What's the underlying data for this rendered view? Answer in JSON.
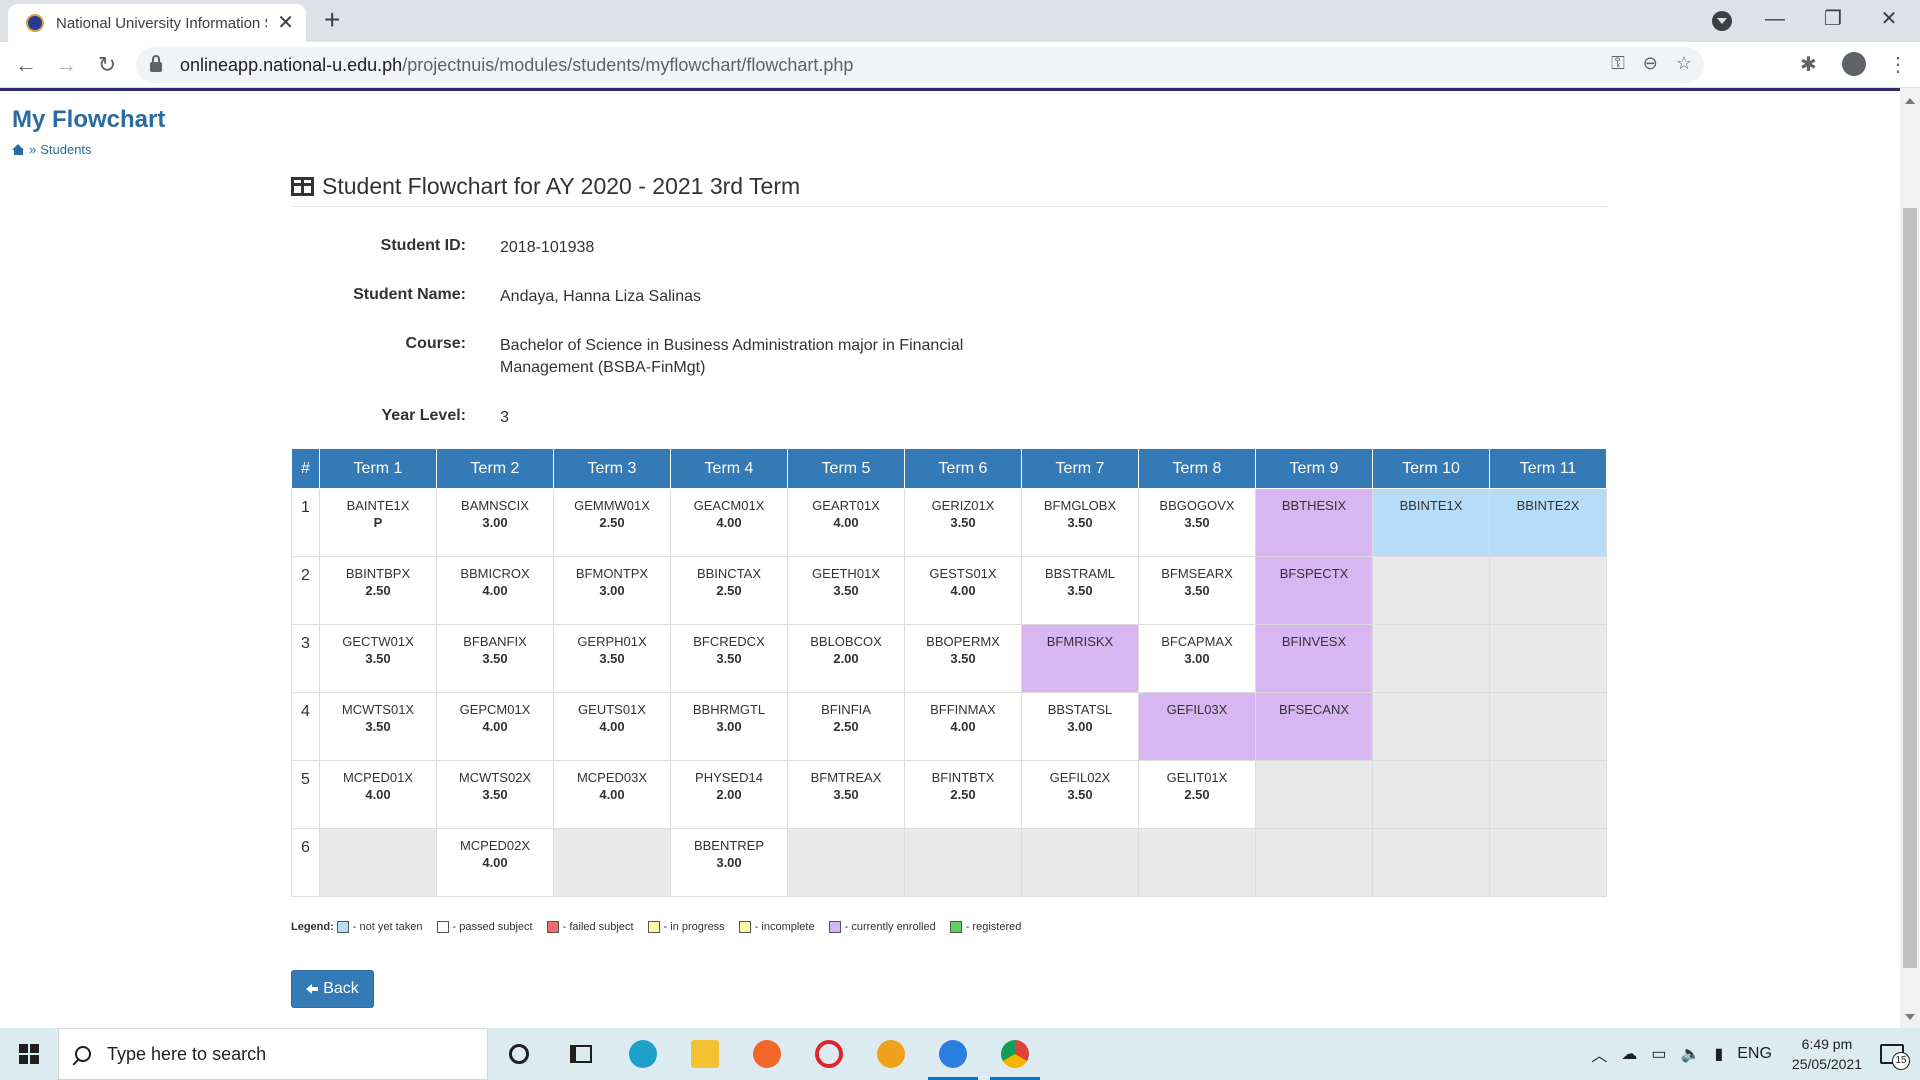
{
  "browser": {
    "tab_title": "National University Information S",
    "url_host": "onlineapp.national-u.edu.ph",
    "url_path": "/projectnuis/modules/students/myflowchart/flowchart.php"
  },
  "page": {
    "title": "My Flowchart",
    "breadcrumb": "Students",
    "breadcrumb_sep": "»",
    "section_title": "Student Flowchart for AY 2020 - 2021 3rd Term"
  },
  "student": {
    "id_label": "Student ID:",
    "id": "2018-101938",
    "name_label": "Student Name:",
    "name": "Andaya, Hanna Liza Salinas",
    "course_label": "Course:",
    "course": "Bachelor of Science in Business Administration major in Financial Management (BSBA-FinMgt)",
    "year_label": "Year Level:",
    "year": "3"
  },
  "flowchart": {
    "headers": [
      "#",
      "Term 1",
      "Term 2",
      "Term 3",
      "Term 4",
      "Term 5",
      "Term 6",
      "Term 7",
      "Term 8",
      "Term 9",
      "Term 10",
      "Term 11"
    ],
    "rows": [
      {
        "num": "1",
        "cells": [
          {
            "code": "BAINTE1X",
            "grade": "P",
            "status": "passed"
          },
          {
            "code": "BAMNSCIX",
            "grade": "3.00",
            "status": "passed"
          },
          {
            "code": "GEMMW01X",
            "grade": "2.50",
            "status": "passed"
          },
          {
            "code": "GEACM01X",
            "grade": "4.00",
            "status": "passed"
          },
          {
            "code": "GEART01X",
            "grade": "4.00",
            "status": "passed"
          },
          {
            "code": "GERIZ01X",
            "grade": "3.50",
            "status": "passed"
          },
          {
            "code": "BFMGLOBX",
            "grade": "3.50",
            "status": "passed"
          },
          {
            "code": "BBGOGOVX",
            "grade": "3.50",
            "status": "passed"
          },
          {
            "code": "BBTHESIX",
            "grade": "",
            "status": "enrolled"
          },
          {
            "code": "BBINTE1X",
            "grade": "",
            "status": "nottaken"
          },
          {
            "code": "BBINTE2X",
            "grade": "",
            "status": "nottaken"
          }
        ]
      },
      {
        "num": "2",
        "cells": [
          {
            "code": "BBINTBPX",
            "grade": "2.50",
            "status": "passed"
          },
          {
            "code": "BBMICROX",
            "grade": "4.00",
            "status": "passed"
          },
          {
            "code": "BFMONTPX",
            "grade": "3.00",
            "status": "passed"
          },
          {
            "code": "BBINCTAX",
            "grade": "2.50",
            "status": "passed"
          },
          {
            "code": "GEETH01X",
            "grade": "3.50",
            "status": "passed"
          },
          {
            "code": "GESTS01X",
            "grade": "4.00",
            "status": "passed"
          },
          {
            "code": "BBSTRAML",
            "grade": "3.50",
            "status": "passed"
          },
          {
            "code": "BFMSEARX",
            "grade": "3.50",
            "status": "passed"
          },
          {
            "code": "BFSPECTX",
            "grade": "",
            "status": "enrolled"
          },
          {
            "code": "",
            "grade": "",
            "status": "empty"
          },
          {
            "code": "",
            "grade": "",
            "status": "empty"
          }
        ]
      },
      {
        "num": "3",
        "cells": [
          {
            "code": "GECTW01X",
            "grade": "3.50",
            "status": "passed"
          },
          {
            "code": "BFBANFIX",
            "grade": "3.50",
            "status": "passed"
          },
          {
            "code": "GERPH01X",
            "grade": "3.50",
            "status": "passed"
          },
          {
            "code": "BFCREDCX",
            "grade": "3.50",
            "status": "passed"
          },
          {
            "code": "BBLOBCOX",
            "grade": "2.00",
            "status": "passed"
          },
          {
            "code": "BBOPERMX",
            "grade": "3.50",
            "status": "passed"
          },
          {
            "code": "BFMRISKX",
            "grade": "",
            "status": "enrolled"
          },
          {
            "code": "BFCAPMAX",
            "grade": "3.00",
            "status": "passed"
          },
          {
            "code": "BFINVESX",
            "grade": "",
            "status": "enrolled"
          },
          {
            "code": "",
            "grade": "",
            "status": "empty"
          },
          {
            "code": "",
            "grade": "",
            "status": "empty"
          }
        ]
      },
      {
        "num": "4",
        "cells": [
          {
            "code": "MCWTS01X",
            "grade": "3.50",
            "status": "passed"
          },
          {
            "code": "GEPCM01X",
            "grade": "4.00",
            "status": "passed"
          },
          {
            "code": "GEUTS01X",
            "grade": "4.00",
            "status": "passed"
          },
          {
            "code": "BBHRMGTL",
            "grade": "3.00",
            "status": "passed"
          },
          {
            "code": "BFINFIA",
            "grade": "2.50",
            "status": "passed"
          },
          {
            "code": "BFFINMAX",
            "grade": "4.00",
            "status": "passed"
          },
          {
            "code": "BBSTATSL",
            "grade": "3.00",
            "status": "passed"
          },
          {
            "code": "GEFIL03X",
            "grade": "",
            "status": "enrolled"
          },
          {
            "code": "BFSECANX",
            "grade": "",
            "status": "enrolled"
          },
          {
            "code": "",
            "grade": "",
            "status": "empty"
          },
          {
            "code": "",
            "grade": "",
            "status": "empty"
          }
        ]
      },
      {
        "num": "5",
        "cells": [
          {
            "code": "MCPED01X",
            "grade": "4.00",
            "status": "passed"
          },
          {
            "code": "MCWTS02X",
            "grade": "3.50",
            "status": "passed"
          },
          {
            "code": "MCPED03X",
            "grade": "4.00",
            "status": "passed"
          },
          {
            "code": "PHYSED14",
            "grade": "2.00",
            "status": "passed"
          },
          {
            "code": "BFMTREAX",
            "grade": "3.50",
            "status": "passed"
          },
          {
            "code": "BFINTBTX",
            "grade": "2.50",
            "status": "passed"
          },
          {
            "code": "GEFIL02X",
            "grade": "3.50",
            "status": "passed"
          },
          {
            "code": "GELIT01X",
            "grade": "2.50",
            "status": "passed"
          },
          {
            "code": "",
            "grade": "",
            "status": "empty"
          },
          {
            "code": "",
            "grade": "",
            "status": "empty"
          },
          {
            "code": "",
            "grade": "",
            "status": "empty"
          }
        ]
      },
      {
        "num": "6",
        "cells": [
          {
            "code": "",
            "grade": "",
            "status": "empty"
          },
          {
            "code": "MCPED02X",
            "grade": "4.00",
            "status": "passed"
          },
          {
            "code": "",
            "grade": "",
            "status": "empty"
          },
          {
            "code": "BBENTREP",
            "grade": "3.00",
            "status": "passed"
          },
          {
            "code": "",
            "grade": "",
            "status": "empty"
          },
          {
            "code": "",
            "grade": "",
            "status": "empty"
          },
          {
            "code": "",
            "grade": "",
            "status": "empty"
          },
          {
            "code": "",
            "grade": "",
            "status": "empty"
          },
          {
            "code": "",
            "grade": "",
            "status": "empty"
          },
          {
            "code": "",
            "grade": "",
            "status": "empty"
          },
          {
            "code": "",
            "grade": "",
            "status": "empty"
          }
        ]
      }
    ]
  },
  "legend": {
    "title": "Legend:",
    "items": [
      {
        "label": "- not yet taken",
        "color": "#b7dcf7"
      },
      {
        "label": "- passed subject",
        "color": "#ffffff"
      },
      {
        "label": "- failed subject",
        "color": "#f26b6b"
      },
      {
        "label": "- in progress",
        "color": "#fff9a6"
      },
      {
        "label": "- incomplete",
        "color": "#fff9a6"
      },
      {
        "label": "- currently enrolled",
        "color": "#d7b6f2"
      },
      {
        "label": "- registered",
        "color": "#5fd35f"
      }
    ]
  },
  "back_button": "Back",
  "taskbar": {
    "search_placeholder": "Type here to search",
    "language": "ENG",
    "time": "6:49 pm",
    "date": "25/05/2021",
    "notification_count": "15"
  },
  "colors": {
    "accent": "#337ab7",
    "title": "#2a6c9f",
    "enrolled": "#d7b6f2",
    "not_taken": "#b7dcf7",
    "empty_cell": "#e9e9e9"
  }
}
